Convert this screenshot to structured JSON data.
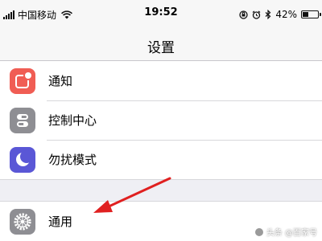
{
  "status_bar": {
    "carrier": "中国移动",
    "time": "19:52",
    "battery_percent": "42%",
    "battery_level": 0.42,
    "icons": [
      "signal-bars-icon",
      "wifi-icon",
      "orientation-lock-icon",
      "alarm-icon",
      "bluetooth-icon",
      "battery-icon"
    ]
  },
  "nav": {
    "title": "设置"
  },
  "settings_group_1": [
    {
      "label": "通知",
      "icon": "notifications-icon",
      "icon_color": "#f05d54"
    },
    {
      "label": "控制中心",
      "icon": "control-center-icon",
      "icon_color": "#8e8e93"
    },
    {
      "label": "勿扰模式",
      "icon": "moon-icon",
      "icon_color": "#5a57d6"
    }
  ],
  "settings_group_2": [
    {
      "label": "通用",
      "icon": "gear-icon",
      "icon_color": "#8e8e93"
    }
  ],
  "annotation": {
    "arrow_color": "#e02020",
    "icon": "red-arrow-icon"
  },
  "watermark": {
    "text": "头条 @百家号"
  }
}
